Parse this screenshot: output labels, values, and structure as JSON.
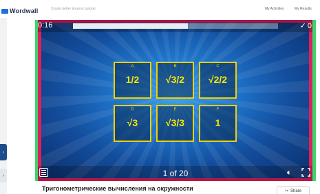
{
  "app": {
    "logo_text": "Wordwall",
    "tagline": "Create better lessons quicker",
    "my_activities": "My Activities",
    "my_results": "My Results"
  },
  "game": {
    "timer": "0:16",
    "progress": 0.56,
    "score": "0",
    "counter": "1 of 20",
    "tiles": [
      {
        "letter": "A",
        "value": "1/2"
      },
      {
        "letter": "B",
        "value": "√3/2"
      },
      {
        "letter": "C",
        "value": "√2/2"
      },
      {
        "letter": "D",
        "value": "√3"
      },
      {
        "letter": "E",
        "value": "√3/3"
      },
      {
        "letter": "F",
        "value": "1"
      }
    ],
    "colors": {
      "border_outer": "#3ed46c",
      "border_inner": "#e11e5d",
      "tile_border": "#f1d000",
      "tile_text": "#ffe600"
    }
  },
  "activity": {
    "title": "Тригонометрические вычисления на окружности",
    "share_label": "Share"
  },
  "icons": {
    "check": "✓",
    "sound": "🔈︎",
    "share": "↪",
    "side_tab_arrow": "‹",
    "side_tab2_arrow": "›"
  }
}
